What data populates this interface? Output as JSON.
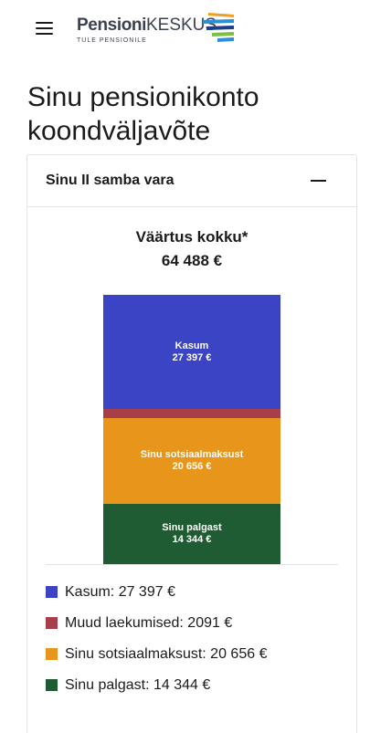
{
  "header": {
    "menu_icon": "hamburger-menu-icon",
    "logo": {
      "word_bold": "Pensioni",
      "word_regular": "KESKUS",
      "tagline": "TULE PENSIONILE"
    }
  },
  "page": {
    "title": "Sinu pensionikonto koondväljavõte"
  },
  "card": {
    "title": "Sinu II samba vara",
    "toggle_icon": "minus-collapse-icon",
    "total_label": "Väärtus kokku*",
    "total_value": "64 488 €"
  },
  "chart_data": {
    "type": "bar",
    "stacked": true,
    "total": 64488,
    "unit": "€",
    "series": [
      {
        "name": "Kasum",
        "value": 27397,
        "display": "27 397",
        "color": "#3a44c4",
        "label_inside": true
      },
      {
        "name": "Muud laekumised",
        "value": 2091,
        "display": "2091",
        "color": "#a83e4a",
        "label_inside": false
      },
      {
        "name": "Sinu sotsiaalmaksust",
        "value": 20656,
        "display": "20 656",
        "color": "#e8951b",
        "label_inside": true
      },
      {
        "name": "Sinu palgast",
        "value": 14344,
        "display": "14 344",
        "color": "#1f5c33",
        "label_inside": true
      }
    ]
  },
  "legend": [
    {
      "text": "Kasum: 27 397 €",
      "color": "#3a44c4"
    },
    {
      "text": "Muud laekumised: 2091 €",
      "color": "#a83e4a"
    },
    {
      "text": "Sinu sotsiaalmaksust: 20 656 €",
      "color": "#e8951b"
    },
    {
      "text": "Sinu palgast: 14 344 €",
      "color": "#1f5c33"
    }
  ]
}
